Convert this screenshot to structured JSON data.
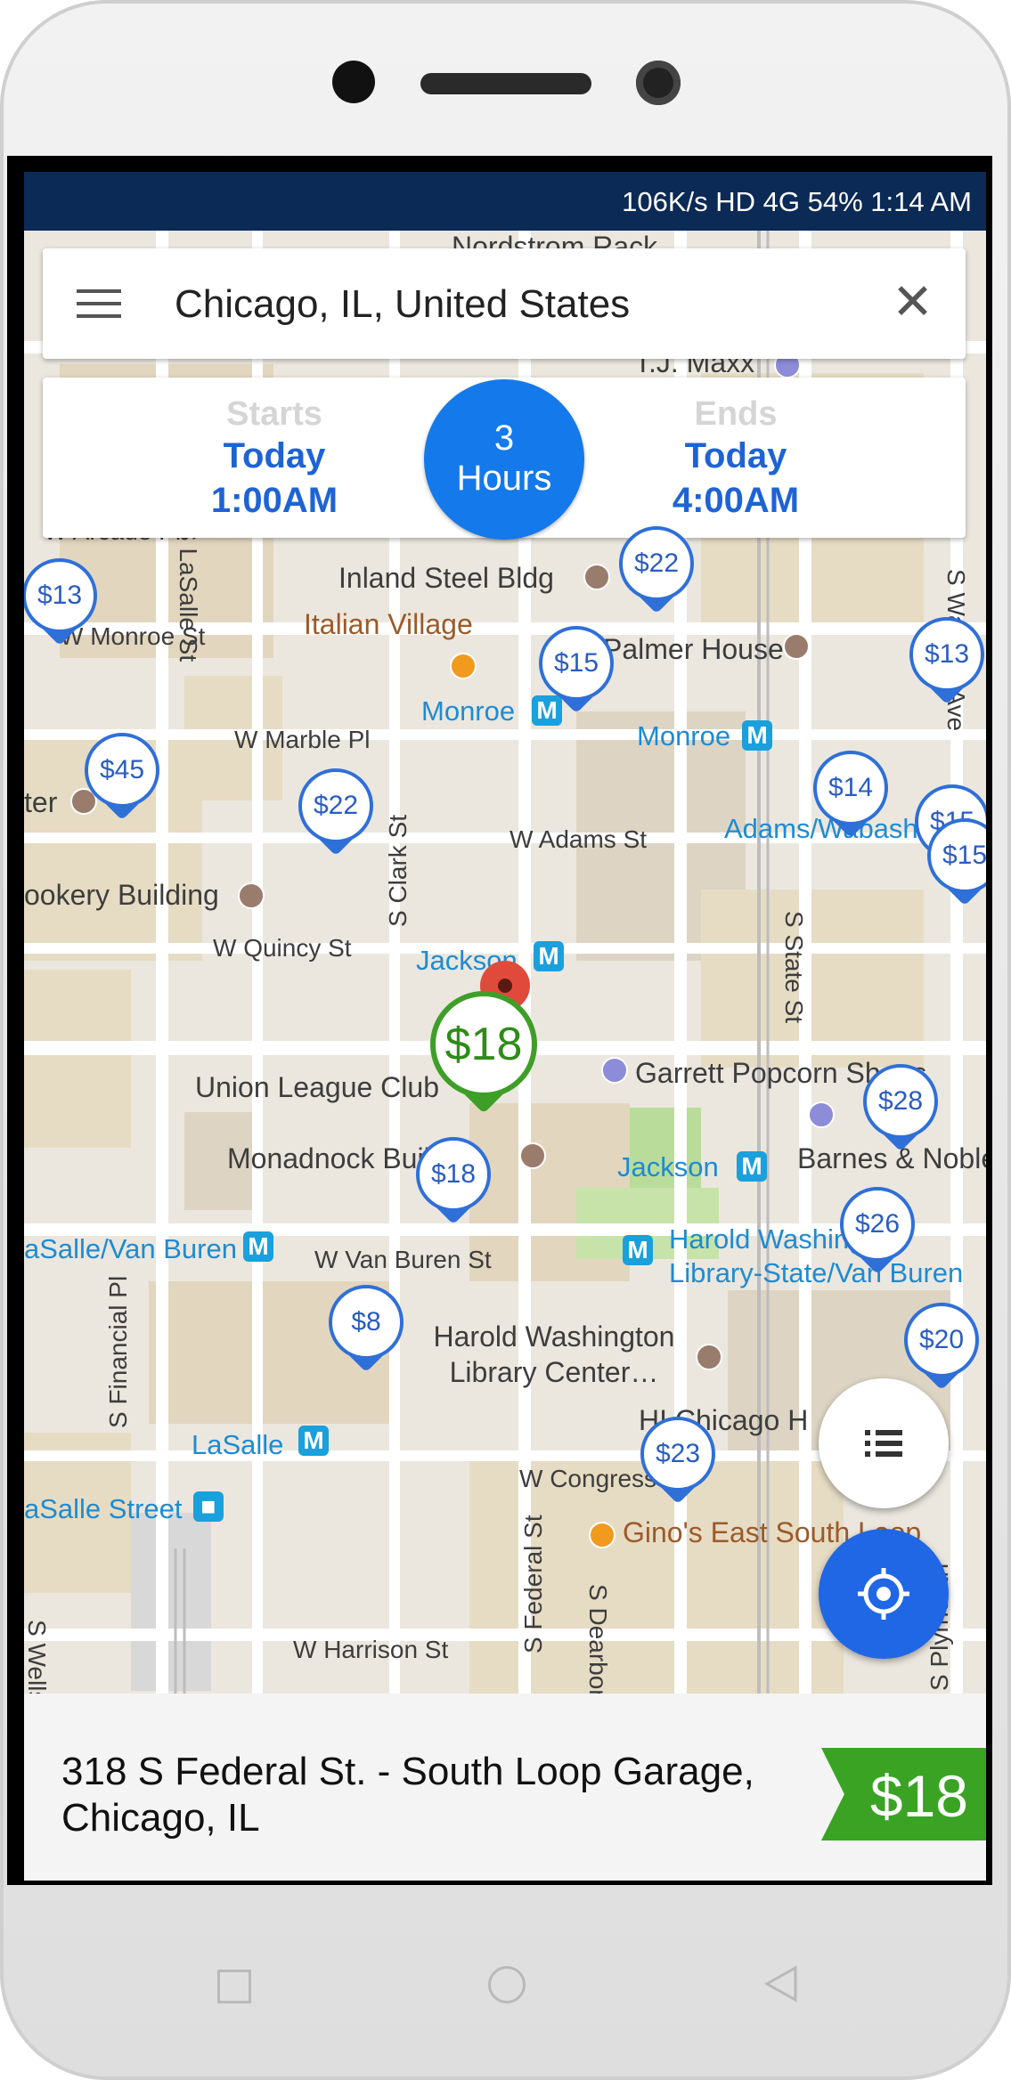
{
  "status_bar": {
    "text": "106K/s  HD 4G  54%  1:14 AM"
  },
  "search": {
    "menu_icon": "hamburger-menu-icon",
    "query": "Chicago, IL, United States",
    "clear_icon": "close-icon",
    "clear_glyph": "✕"
  },
  "time_selector": {
    "start": {
      "label": "Starts",
      "day": "Today",
      "time": "1:00AM"
    },
    "duration": {
      "value": "3",
      "unit": "Hours"
    },
    "end": {
      "label": "Ends",
      "day": "Today",
      "time": "4:00AM"
    }
  },
  "map": {
    "labels": {
      "nordstrom": "Nordstrom Rack",
      "tjmaxx": "T.J. Maxx",
      "w_arcade": "W Arcade Pl",
      "lasalle_st": "S LaSalle St",
      "inland_steel": "Inland Steel Bldg",
      "italian_village": "Italian Village",
      "palmer_house": "Palmer House",
      "w_monroe": "W Monroe St",
      "monroe1": "Monroe",
      "monroe2": "Monroe",
      "w_marble": "W Marble Pl",
      "center": "ter",
      "w_adams": "W Adams St",
      "adams_wabash": "Adams/Wabash",
      "rookery": "ookery Building",
      "s_clark": "S Clark St",
      "w_quincy": "W Quincy St",
      "jackson1": "Jackson",
      "s_state": "S State St",
      "s_wabash": "S Wabash Ave",
      "union_league": "Union League Club",
      "garrett": "Garrett Popcorn Shops",
      "monadnock": "Monadnock Building",
      "jackson2": "Jackson",
      "barnes": "Barnes & Noble",
      "lasalle_van_buren": "aSalle/Van Buren",
      "w_van_buren": "W Van Buren St",
      "harold_station": "Harold Washington Library-State/Van Buren",
      "s_financial": "S Financial Pl",
      "harold_library": "Harold Washington Library Center…",
      "hi_chicago": "HI Chicago H",
      "lasalle": "LaSalle",
      "w_congress": "W Congress",
      "lasalle_street": "aSalle Street",
      "ginos": "Gino's East South Loop",
      "s_federal": "S Federal St",
      "s_dearborn": "S Dearborn",
      "w_harrison": "W Harrison St",
      "s_wells": "S Wells",
      "s_plymouth": "S Plymouth"
    },
    "price_pins": [
      "$22",
      "$13",
      "$15",
      "$13",
      "$45",
      "$22",
      "$14",
      "$15",
      "$15",
      "$28",
      "$18",
      "$26",
      "$8",
      "$20",
      "$23"
    ],
    "selected_pin": "$18"
  },
  "list_fab_icon": "list-view-icon",
  "locate_fab_icon": "my-location-icon",
  "selected_listing": {
    "address": "318 S Federal St. - South Loop Garage, Chicago, IL",
    "price": "$18"
  },
  "nav_icons": [
    "recents-icon",
    "home-icon",
    "back-icon"
  ]
}
